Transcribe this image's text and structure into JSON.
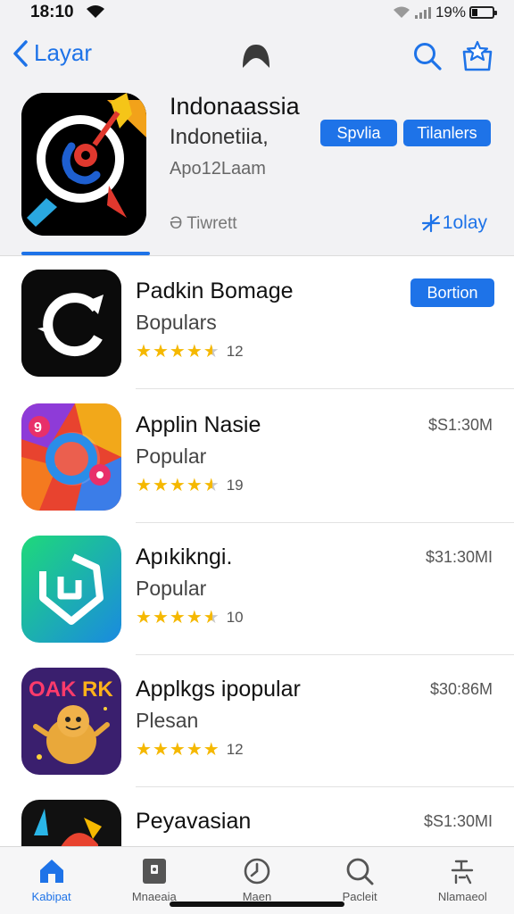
{
  "status": {
    "time": "18:10",
    "battery_pct": "19%"
  },
  "nav": {
    "back_label": "Layar",
    "icons": [
      "chevron-left-icon",
      "app-logo-icon",
      "search-icon",
      "star-favorite-icon"
    ]
  },
  "featured": {
    "title": "Indonaassia",
    "subtitle": "Indonetiia,",
    "meta": "Apo12Laam",
    "button_1": "Spvlia",
    "button_2": "Tilanlers",
    "tweet": "Ə Tiwrett",
    "today": "1olay"
  },
  "apps": [
    {
      "name": "Padkin Bomage",
      "category": "Bopulars",
      "rating": 4.5,
      "rating_count": "12",
      "action_label": "Bortion",
      "price": ""
    },
    {
      "name": "Applin Nasie",
      "category": "Popular",
      "rating": 4.5,
      "rating_count": "19",
      "action_label": "",
      "price": "$S1:30M"
    },
    {
      "name": "Apıkikngi.",
      "category": "Popular",
      "rating": 4.5,
      "rating_count": "10",
      "action_label": "",
      "price": "$31:30MI"
    },
    {
      "name": "Applkgs ipopular",
      "category": "Plesan",
      "rating": 5,
      "rating_count": "12",
      "action_label": "",
      "price": "$30:86M"
    },
    {
      "name": "Peyavasian",
      "category": "",
      "rating": 0,
      "rating_count": "",
      "action_label": "",
      "price": "$S1:30MI"
    }
  ],
  "tabs": [
    {
      "label": "Kabipat",
      "icon": "home-icon",
      "active": true
    },
    {
      "label": "Mnaeaia",
      "icon": "media-icon",
      "active": false
    },
    {
      "label": "Maen",
      "icon": "clock-icon",
      "active": false
    },
    {
      "label": "Pacleit",
      "icon": "search-icon",
      "active": false
    },
    {
      "label": "Nlamaeol",
      "icon": "updates-icon",
      "active": false
    }
  ],
  "colors": {
    "accent": "#1e73e8",
    "star": "#f5b800",
    "header_bg": "#f2f2f4"
  }
}
